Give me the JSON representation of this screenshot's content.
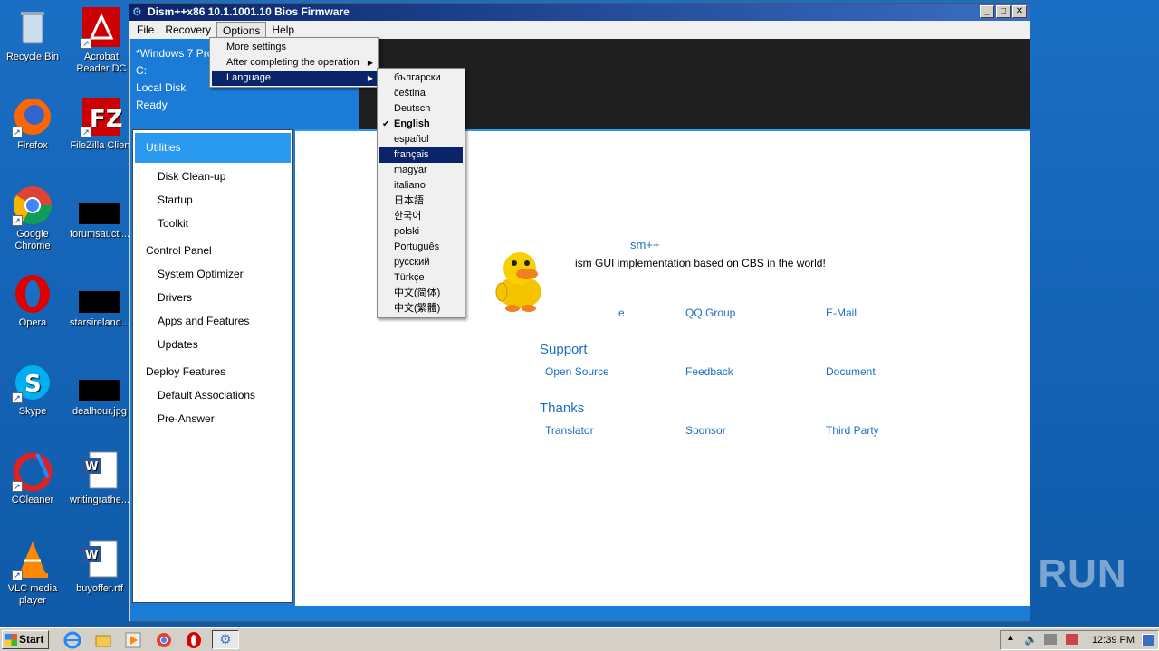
{
  "desktop": {
    "icons": [
      {
        "label": "Recycle Bin",
        "icon": "recycle-bin-icon"
      },
      {
        "label": "Acrobat Reader DC",
        "icon": "acrobat-icon"
      },
      {
        "label": "Firefox",
        "icon": "firefox-icon"
      },
      {
        "label": "FileZilla Client",
        "icon": "filezilla-icon"
      },
      {
        "label": "Google Chrome",
        "icon": "chrome-icon"
      },
      {
        "label": "forumsaucti...",
        "icon": "file-thumbnail-icon"
      },
      {
        "label": "Opera",
        "icon": "opera-icon"
      },
      {
        "label": "starsireland...",
        "icon": "file-thumbnail-icon"
      },
      {
        "label": "Skype",
        "icon": "skype-icon"
      },
      {
        "label": "dealhour.jpg",
        "icon": "image-file-icon"
      },
      {
        "label": "CCleaner",
        "icon": "ccleaner-icon"
      },
      {
        "label": "writingrathe...",
        "icon": "word-doc-icon"
      },
      {
        "label": "VLC media player",
        "icon": "vlc-icon"
      },
      {
        "label": "buyoffer.rtf",
        "icon": "word-doc-icon"
      }
    ]
  },
  "window": {
    "title": "Dism++x86 10.1.1001.10 Bios Firmware",
    "menu": [
      "File",
      "Recovery",
      "Options",
      "Help"
    ],
    "header": {
      "os": "*Windows 7 Pro",
      "drive": "C:",
      "disk": "Local Disk",
      "status": "Ready"
    },
    "sidebar": {
      "selected": "Utilities",
      "utilities": [
        "Disk Clean-up",
        "Startup",
        "Toolkit"
      ],
      "control_panel": "Control Panel",
      "control_items": [
        "System Optimizer",
        "Drivers",
        "Apps and Features",
        "Updates"
      ],
      "deploy": "Deploy Features",
      "deploy_items": [
        "Default Associations",
        "Pre-Answer"
      ]
    },
    "about": {
      "title": "sm++",
      "desc": "ism GUI implementation based on CBS in the world!",
      "row1": [
        "e",
        "QQ Group",
        "E-Mail"
      ],
      "support": "Support",
      "support_links": [
        "Open Source",
        "Feedback",
        "Document"
      ],
      "thanks": "Thanks",
      "thanks_links": [
        "Translator",
        "Sponsor",
        "Third Party"
      ]
    }
  },
  "options_menu": [
    "More settings",
    "After completing the operation",
    "Language"
  ],
  "language_menu": {
    "items": [
      "български",
      "čeština",
      "Deutsch",
      "English",
      "español",
      "français",
      "magyar",
      "italiano",
      "日本語",
      "한국어",
      "polski",
      "Português",
      "русский",
      "Türkçe",
      "中文(简体)",
      "中文(繁體)"
    ],
    "checked": "English",
    "hovered": "français"
  },
  "taskbar": {
    "start": "Start",
    "clock": "12:39 PM"
  },
  "watermark": "ANY RUN"
}
